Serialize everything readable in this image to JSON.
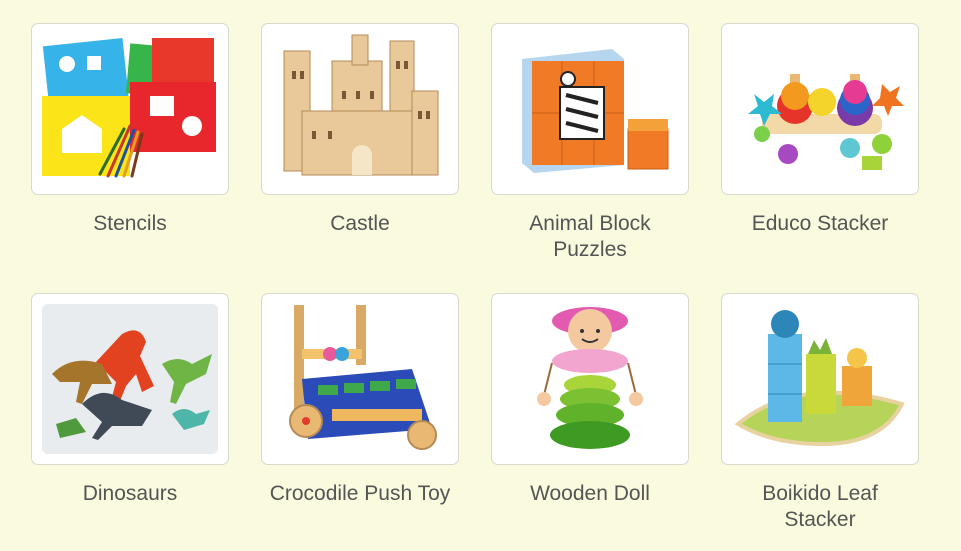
{
  "products": [
    {
      "id": "stencils",
      "label": "Stencils",
      "icon": "stencils-image"
    },
    {
      "id": "castle",
      "label": "Castle",
      "icon": "castle-image"
    },
    {
      "id": "animal-block-puzzles",
      "label": "Animal Block Puzzles",
      "icon": "animal-block-puzzle-image"
    },
    {
      "id": "educo-stacker",
      "label": "Educo Stacker",
      "icon": "educo-stacker-image"
    },
    {
      "id": "dinosaurs",
      "label": "Dinosaurs",
      "icon": "dinosaurs-image"
    },
    {
      "id": "crocodile-push-toy",
      "label": "Crocodile Push Toy",
      "icon": "crocodile-push-toy-image"
    },
    {
      "id": "wooden-doll",
      "label": "Wooden Doll",
      "icon": "wooden-doll-image"
    },
    {
      "id": "boikido-leaf-stacker",
      "label": "Boikido Leaf Stacker",
      "icon": "boikido-leaf-stacker-image"
    }
  ],
  "colors": {
    "page_background": "#fafadf",
    "card_border": "#d9d9d0",
    "label_text": "#555555"
  }
}
